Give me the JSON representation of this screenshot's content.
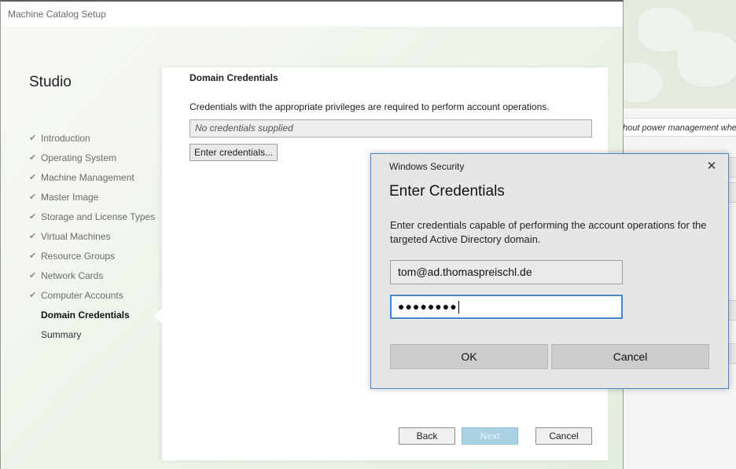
{
  "wizard": {
    "title": "Machine Catalog Setup",
    "studio_label": "Studio",
    "steps": [
      {
        "label": "Introduction",
        "state": "done"
      },
      {
        "label": "Operating System",
        "state": "done"
      },
      {
        "label": "Machine Management",
        "state": "done"
      },
      {
        "label": "Master Image",
        "state": "done"
      },
      {
        "label": "Storage and License Types",
        "state": "done"
      },
      {
        "label": "Virtual Machines",
        "state": "done"
      },
      {
        "label": "Resource Groups",
        "state": "done"
      },
      {
        "label": "Network Cards",
        "state": "done"
      },
      {
        "label": "Computer Accounts",
        "state": "done"
      },
      {
        "label": "Domain Credentials",
        "state": "current"
      },
      {
        "label": "Summary",
        "state": "pending"
      }
    ],
    "check_glyph": "✔",
    "content": {
      "section_title": "Domain Credentials",
      "description": "Credentials with the appropriate privileges are required to perform account operations.",
      "credentials_value": "No credentials supplied",
      "enter_credentials_label": "Enter credentials..."
    },
    "buttons": {
      "back": "Back",
      "next": "Next",
      "cancel": "Cancel"
    }
  },
  "background_app": {
    "strip_text": "hout power management wher",
    "colors": {
      "decor": "#e3ebe0"
    }
  },
  "dialog": {
    "caption": "Windows Security",
    "close_glyph": "✕",
    "heading": "Enter Credentials",
    "message": "Enter credentials capable of performing the account operations for the targeted Active Directory domain.",
    "username": "tom@ad.thomaspreischl.de",
    "password_mask": "●●●●●●●●",
    "ok_label": "OK",
    "cancel_label": "Cancel"
  },
  "colors": {
    "accent": "#4a86c8",
    "next_disabled": "#a9d2e3"
  }
}
